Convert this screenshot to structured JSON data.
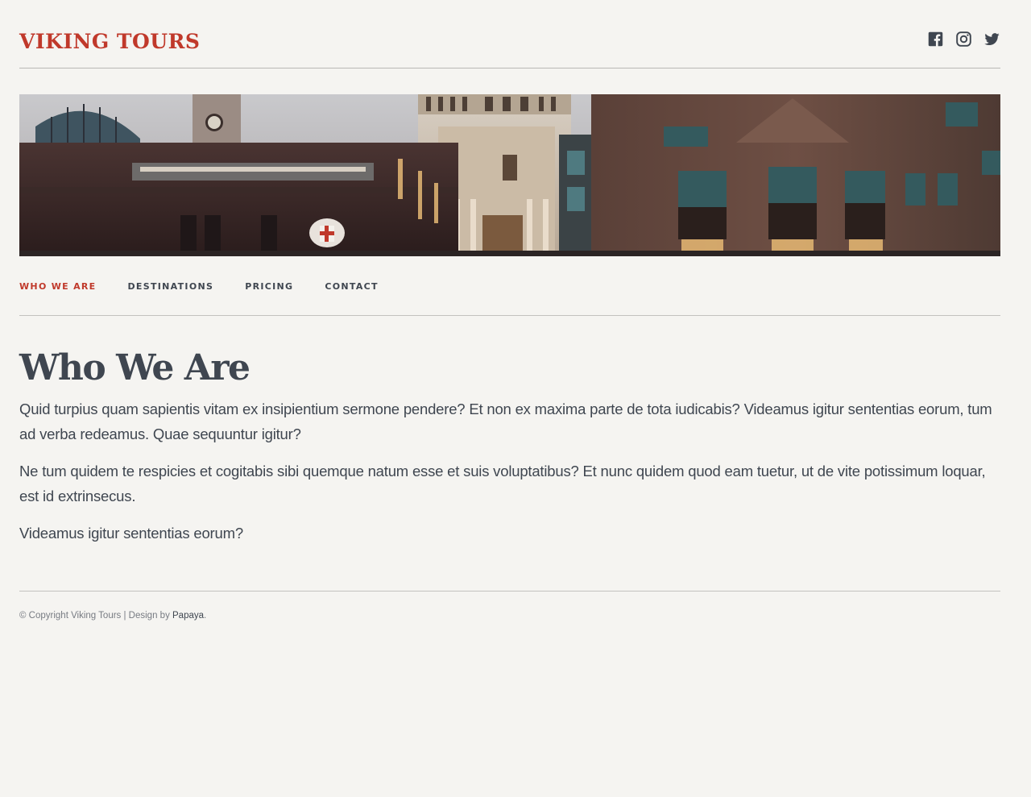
{
  "header": {
    "logo": "VIKING TOURS",
    "social": [
      {
        "icon": "facebook-icon"
      },
      {
        "icon": "instagram-icon"
      },
      {
        "icon": "twitter-icon"
      }
    ]
  },
  "nav": {
    "items": [
      {
        "label": "WHO WE ARE",
        "active": true
      },
      {
        "label": "DESTINATIONS",
        "active": false
      },
      {
        "label": "PRICING",
        "active": false
      },
      {
        "label": "CONTACT",
        "active": false
      }
    ]
  },
  "main": {
    "title": "Who We Are",
    "paragraphs": [
      "Quid turpius quam sapientis vitam ex insipientium sermone pendere? Et non ex maxima parte de tota iudicabis? Videamus igitur sententias eorum, tum ad verba redeamus. Quae sequuntur igitur?",
      "Ne tum quidem te respicies et cogitabis sibi quemque natum esse et suis voluptatibus? Et nunc quidem quod eam tuetur, ut de vite potissimum loquar, est id extrinsecus.",
      "Videamus igitur sententias eorum?"
    ]
  },
  "footer": {
    "copyright": "© Copyright Viking Tours | Design by ",
    "designer": "Papaya",
    "suffix": "."
  },
  "colors": {
    "accent": "#c0392b",
    "text": "#3f4650",
    "background": "#f5f4f1"
  }
}
